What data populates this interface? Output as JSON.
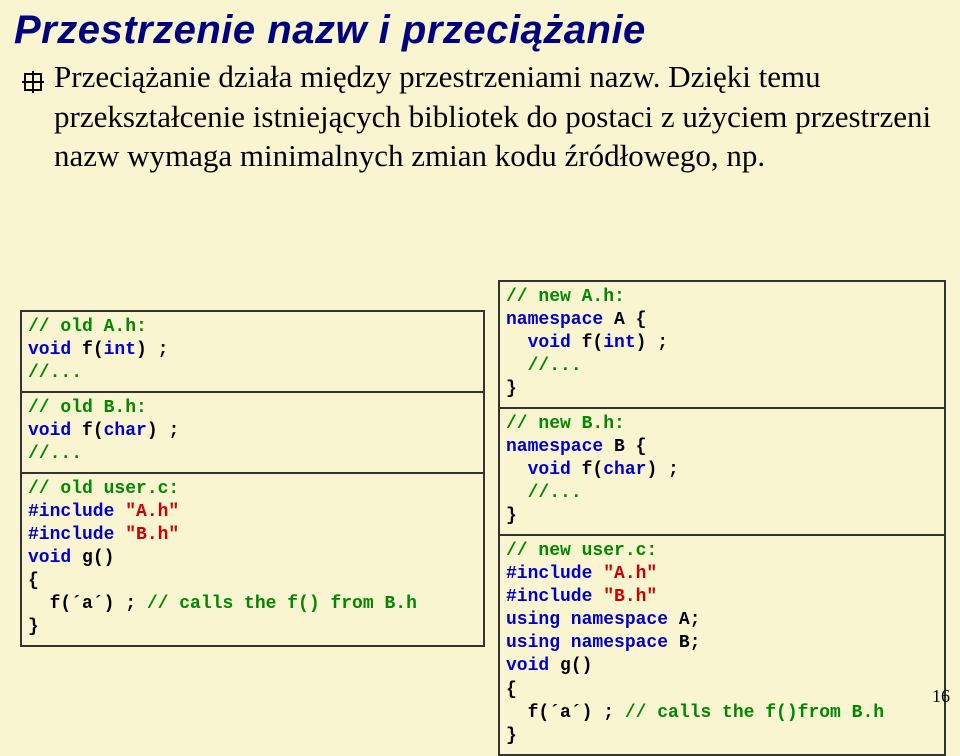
{
  "title": "Przestrzenie nazw i przeciążanie",
  "body": "Przeciążanie działa między przestrzeniami nazw. Dzięki temu przekształcenie istniejących bibliotek do postaci z użyciem przestrzeni nazw wymaga minimalnych zmian kodu źródłowego, np.",
  "left": {
    "b1": {
      "l1": "// old A.h:",
      "l2_a": "void",
      "l2_b": " f(",
      "l2_c": "int",
      "l2_d": ") ;",
      "l3": "//..."
    },
    "b2": {
      "l1": "// old B.h:",
      "l2_a": "void",
      "l2_b": " f(",
      "l2_c": "char",
      "l2_d": ") ;",
      "l3": "//..."
    },
    "b3": {
      "l1": "// old user.c:",
      "l2_a": "#include ",
      "l2_b": "\"A.h\"",
      "l3_a": "#include ",
      "l3_b": "\"B.h\"",
      "l4_a": "void",
      "l4_b": " g()",
      "l5": "{",
      "l6_a": "  f(´a´) ; ",
      "l6_b": "// calls the f() from B.h",
      "l7": "}"
    }
  },
  "right": {
    "b1": {
      "l1": "// new A.h:",
      "l2_a": "namespace",
      "l2_b": " A {",
      "l3_a": "  ",
      "l3_b": "void",
      "l3_c": " f(",
      "l3_d": "int",
      "l3_e": ") ;",
      "l4_a": "  ",
      "l4_b": "//...",
      "l5": "}"
    },
    "b2": {
      "l1": "// new B.h:",
      "l2_a": "namespace",
      "l2_b": " B {",
      "l3_a": "  ",
      "l3_b": "void",
      "l3_c": " f(",
      "l3_d": "char",
      "l3_e": ") ;",
      "l4_a": "  ",
      "l4_b": "//...",
      "l5": "}"
    },
    "b3": {
      "l1": "// new user.c:",
      "l2_a": "#include ",
      "l2_b": "\"A.h\"",
      "l3_a": "#include ",
      "l3_b": "\"B.h\"",
      "l4_a": "using namespace",
      "l4_b": " A;",
      "l5_a": "using namespace",
      "l5_b": " B;",
      "l6_a": "void",
      "l6_b": " g()",
      "l7": "{",
      "l8_a": "  f(´a´) ; ",
      "l8_b": "// calls the f()from B.h",
      "l9": "}"
    }
  },
  "page_num": "16"
}
